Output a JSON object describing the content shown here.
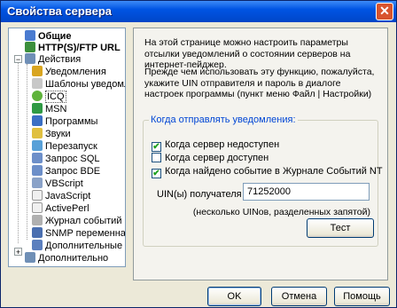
{
  "window": {
    "title": "Свойства сервера",
    "close_glyph": "✕"
  },
  "tree": {
    "items": [
      {
        "label": "Общие",
        "icon": "general-icon",
        "bold": true
      },
      {
        "label": "HTTP(S)/FTP URL",
        "icon": "url-icon",
        "bold": true
      },
      {
        "label": "Действия",
        "icon": "actions-icon",
        "bold": false,
        "expander": "−"
      },
      {
        "label": "Уведомления",
        "icon": "notifications-icon"
      },
      {
        "label": "Шаблоны уведомл",
        "icon": "templates-icon"
      },
      {
        "label": "ICQ",
        "icon": "icq-icon",
        "selected": true
      },
      {
        "label": "MSN",
        "icon": "msn-icon"
      },
      {
        "label": "Программы",
        "icon": "programs-icon"
      },
      {
        "label": "Звуки",
        "icon": "sounds-icon"
      },
      {
        "label": "Перезапуск",
        "icon": "restart-icon"
      },
      {
        "label": "Запрос SQL",
        "icon": "sql-icon"
      },
      {
        "label": "Запрос BDE",
        "icon": "bde-icon"
      },
      {
        "label": "VBScript",
        "icon": "vbscript-icon"
      },
      {
        "label": "JavaScript",
        "icon": "javascript-icon"
      },
      {
        "label": "ActivePerl",
        "icon": "activeperl-icon"
      },
      {
        "label": "Журнал событий",
        "icon": "event-log-icon"
      },
      {
        "label": "SNMP переменна",
        "icon": "snmp-icon"
      },
      {
        "label": "Дополнительные",
        "icon": "extra-icon"
      },
      {
        "label": "Дополнительно",
        "icon": "advanced-icon",
        "expander": "+"
      }
    ]
  },
  "panel": {
    "intro": "На этой странице можно настроить параметры отсылки уведомлений о состоянии серверов на интернет-пейджер.",
    "instructions": "Прежде чем использовать эту функцию, пожалуйста, укажите UIN отправителя и пароль в диалоге настроек программы (пункт меню Файл | Настройки)",
    "group_title": "Когда отправлять уведомления:",
    "checkboxes": [
      {
        "label": "Когда сервер недоступен",
        "checked": true
      },
      {
        "label": "Когда сервер доступен",
        "checked": false
      },
      {
        "label": "Когда найдено событие в Журнале Событий NT",
        "checked": true
      }
    ],
    "uin_label": "UIN(ы) получателя",
    "uin_value": "71252000",
    "uin_hint": "(несколько UINов, разделенных запятой)",
    "test_button": "Тест"
  },
  "buttons": {
    "ok": "OK",
    "cancel": "Отмена",
    "help": "Помощь"
  },
  "colors": {
    "title_bar": "#0054e3",
    "group_title": "#0046d5",
    "window_bg": "#ece9d8"
  }
}
